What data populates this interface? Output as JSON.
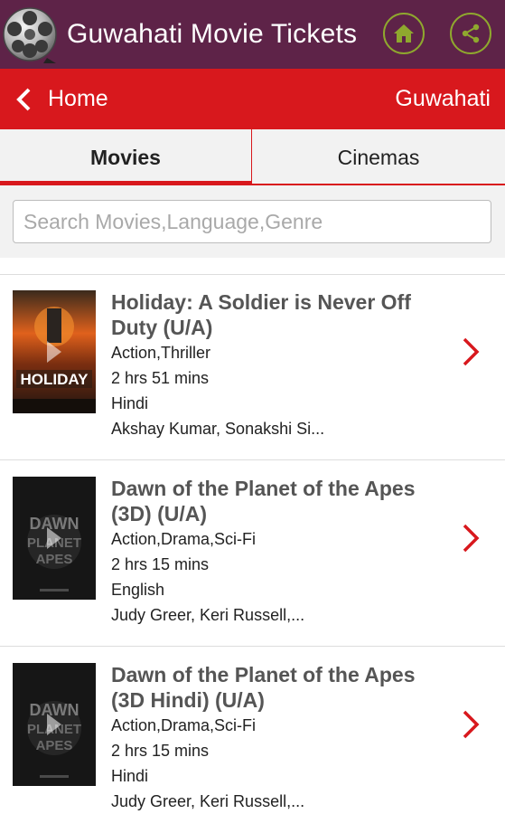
{
  "appbar": {
    "title": "Guwahati Movie Tickets",
    "logo_icon": "film-reel-icon",
    "home_icon": "home-icon",
    "share_icon": "share-icon",
    "bg_color": "#5e2348",
    "icon_color": "#8fa82e"
  },
  "navbar": {
    "back_label": "Home",
    "city": "Guwahati",
    "bg_color": "#d8181d"
  },
  "tabs": [
    {
      "label": "Movies",
      "active": true
    },
    {
      "label": "Cinemas",
      "active": false
    }
  ],
  "search": {
    "placeholder": "Search Movies,Language,Genre",
    "value": ""
  },
  "movies": [
    {
      "title": "Holiday: A Soldier is Never Off Duty (U/A)",
      "genre": "Action,Thriller",
      "duration": "2 hrs 51 mins",
      "language": "Hindi",
      "cast": "Akshay Kumar, Sonakshi Si..."
    },
    {
      "title": "Dawn of the Planet of the Apes (3D) (U/A)",
      "genre": "Action,Drama,Sci-Fi",
      "duration": "2 hrs 15 mins",
      "language": "English",
      "cast": "Judy Greer, Keri Russell,..."
    },
    {
      "title": "Dawn of the Planet of the Apes (3D Hindi) (U/A)",
      "genre": "Action,Drama,Sci-Fi",
      "duration": "2 hrs 15 mins",
      "language": "Hindi",
      "cast": "Judy Greer, Keri Russell,..."
    }
  ]
}
